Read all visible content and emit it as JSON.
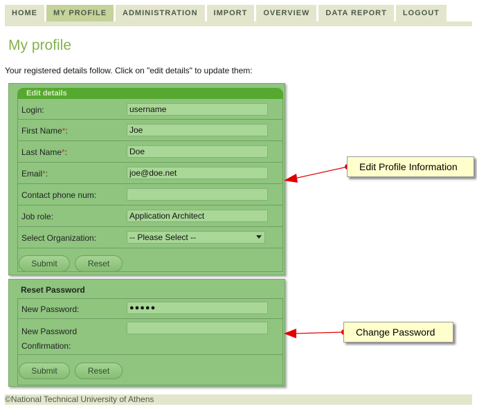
{
  "nav": {
    "tabs": [
      {
        "label": "HOME",
        "active": false
      },
      {
        "label": "MY PROFILE",
        "active": true
      },
      {
        "label": "ADMINISTRATION",
        "active": false
      },
      {
        "label": "IMPORT",
        "active": false
      },
      {
        "label": "OVERVIEW",
        "active": false
      },
      {
        "label": "DATA REPORT",
        "active": false
      },
      {
        "label": "LOGOUT",
        "active": false
      }
    ]
  },
  "page": {
    "title": "My profile",
    "intro": "Your registered details follow. Click on \"edit details\" to update them:"
  },
  "edit_details": {
    "legend": "Edit details",
    "fields": {
      "login": {
        "label": "Login:",
        "value": "username"
      },
      "first_name": {
        "label": "First Name",
        "required_mark": "*",
        "suffix": ":",
        "value": "Joe"
      },
      "last_name": {
        "label": "Last Name",
        "required_mark": "*",
        "suffix": ":",
        "value": "Doe"
      },
      "email": {
        "label": "Email",
        "required_mark": "*",
        "suffix": ":",
        "value": "joe@doe.net"
      },
      "phone": {
        "label": "Contact phone num:",
        "value": ""
      },
      "job_role": {
        "label": "Job role:",
        "value": "Application Architect"
      },
      "organization": {
        "label": "Select Organization:",
        "selected": "-- Please Select --"
      }
    },
    "submit_label": "Submit",
    "reset_label": "Reset"
  },
  "reset_password": {
    "legend": "Reset Password",
    "new_password": {
      "label": "New Password:",
      "value": "●●●●●"
    },
    "confirmation": {
      "label_line1": "New Password",
      "label_line2": "Confirmation:",
      "value": ""
    },
    "submit_label": "Submit",
    "reset_label": "Reset"
  },
  "callouts": {
    "edit_profile": "Edit Profile Information",
    "change_password": "Change Password"
  },
  "footer": {
    "text": "©National Technical University of Athens"
  },
  "colors": {
    "accent_title": "#84b44a",
    "panel_green": "#8fc57f",
    "legend_green": "#55a830",
    "callout_bg": "#ffffcc",
    "arrow_red": "#e00000"
  }
}
